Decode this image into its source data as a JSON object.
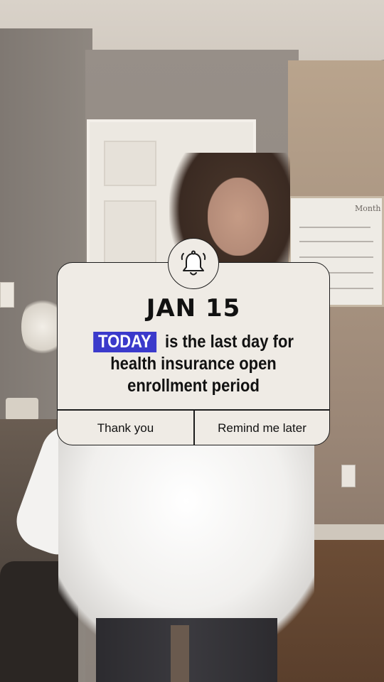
{
  "notification": {
    "icon": "bell-ringing-icon",
    "date": "JAN 15",
    "highlight": "TODAY",
    "message_line1": "is the last day for",
    "message_line2": "health insurance open",
    "message_line3": "enrollment period",
    "highlight_color": "#3b3acb",
    "buttons": {
      "thank_you": "Thank you",
      "remind_later": "Remind me later"
    }
  },
  "whiteboard_heading": "Month"
}
